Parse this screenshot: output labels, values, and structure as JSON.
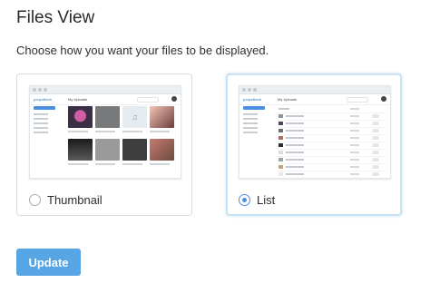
{
  "page": {
    "title": "Files View",
    "subtitle": "Choose how you want your files to be displayed."
  },
  "options": [
    {
      "label": "Thumbnail",
      "selected": false,
      "preview": {
        "logo": "pixpaBank",
        "breadcrumb": "My Uploads"
      }
    },
    {
      "label": "List",
      "selected": true,
      "preview": {
        "logo": "pixpaBank",
        "breadcrumb": "My Uploads"
      }
    }
  ],
  "actions": {
    "update_label": "Update"
  },
  "colors": {
    "accent": "#4a90e2",
    "button": "#57a5e5",
    "selected_border": "#c7e2f4"
  }
}
